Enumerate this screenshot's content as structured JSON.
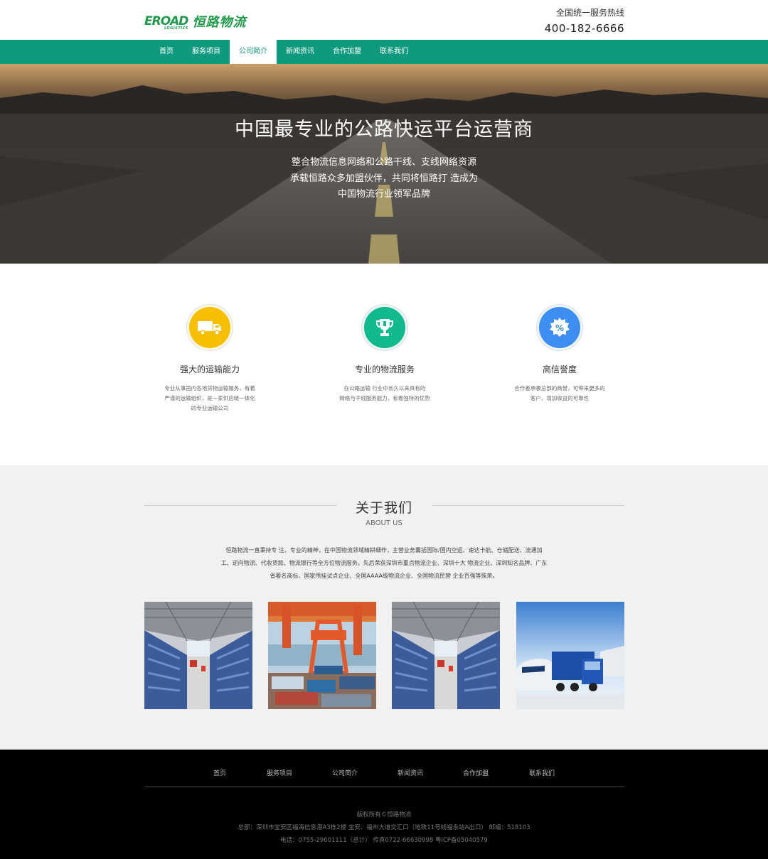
{
  "header": {
    "logo_mark": "EROAD",
    "logo_sub": "LOGISTICS",
    "logo_cn": "恒路物流",
    "hotline_label": "全国统一服务热线",
    "hotline_number": "400-182-6666"
  },
  "nav": {
    "items": [
      "首页",
      "服务项目",
      "公司简介",
      "新闻资讯",
      "合作加盟",
      "联系我们"
    ],
    "active_index": 2
  },
  "hero": {
    "title": "中国最专业的公路快运平台运营商",
    "lines": [
      "整合物流信息网络和公路干线、支线网络资源",
      "承载恒路众多加盟伙伴，共同将恒路打 造成为",
      "中国物流行业领军品牌"
    ]
  },
  "features": [
    {
      "icon": "truck-icon",
      "color": "#f6c000",
      "title": "强大的运输能力",
      "desc": [
        "专业从事国内各地货物运输服务，有着",
        "严谨的运输组织，是一家供应链一体化",
        "的专业运输公司"
      ]
    },
    {
      "icon": "trophy-icon",
      "color": "#12b88e",
      "title": "专业的物流服务",
      "desc": [
        "在公路运输 行业中长久以来具有的",
        "网络与干线服务能力，有着独特的优势"
      ]
    },
    {
      "icon": "percent-badge-icon",
      "color": "#3d8ef0",
      "title": "高信誉度",
      "desc": [
        "合作者承袭总部的商誉，可带来更多的",
        "客户，增加收益的可靠性"
      ]
    }
  ],
  "about": {
    "title": "关于我们",
    "subtitle": "ABOUT US",
    "text": [
      "恒路物流一直秉持专 注、专业的精神，在中国物流领域精耕细作，主营业务囊括国际/国内空运、速达卡航、仓储配送、流通加",
      "工、逆向物流、代收货款、物流银行等全方位物流服务，先后荣获深圳市重点物流企业、深圳十大 物流企业、深圳知名品牌、广东",
      "省著名商标、国家甩挂试点企业、全国AAAA级物流企业、全国物流民营 企业百强等殊荣。"
    ],
    "photos": [
      "warehouse-photo",
      "port-crane-photo",
      "warehouse-photo",
      "truck-train-ship-photo"
    ]
  },
  "footer": {
    "nav": [
      "首页",
      "服务项目",
      "公司简介",
      "新闻资讯",
      "合作加盟",
      "联系我们"
    ],
    "copyright": "版权所有©恒路物流",
    "address": "总部：深圳市宝安区福海信息港A3栋2楼 宝安、福州大道交汇口（地铁11号线福永站A出口） 邮编：518103",
    "contact": "电话：0755-29601111（总计） 传真0722-66630998 粤ICP备05040579"
  },
  "colors": {
    "brand_green": "#0f9a7e",
    "logo_green": "#1f9a4a",
    "logo_orange": "#f2a20f",
    "footer_bg": "#000000",
    "about_bg": "#f1f1f1"
  }
}
